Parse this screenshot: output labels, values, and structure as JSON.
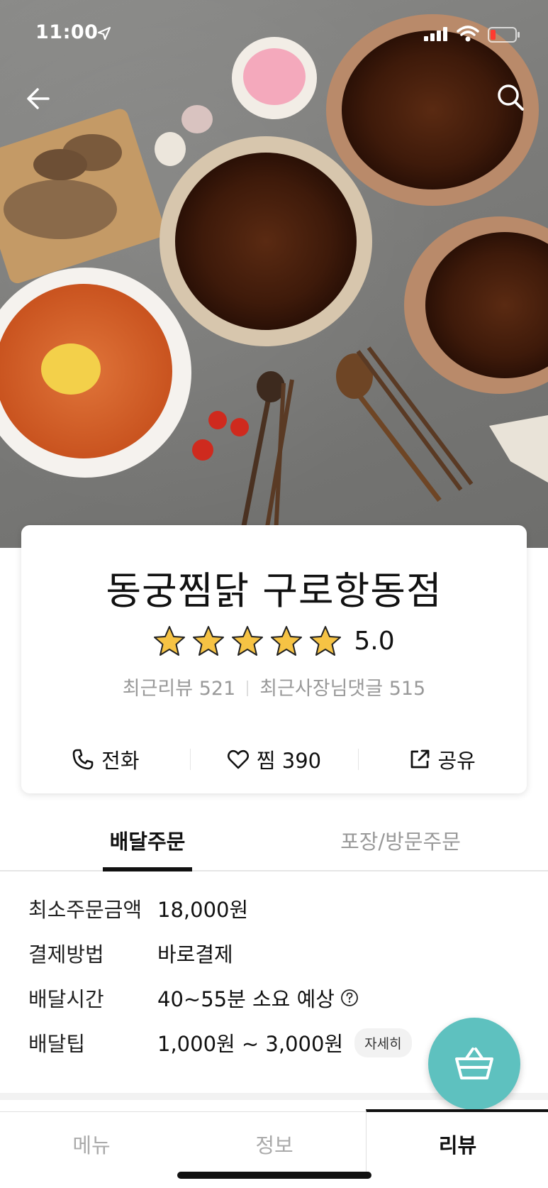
{
  "status_bar": {
    "time": "11:00"
  },
  "store": {
    "name": "동궁찜닭 구로항동점",
    "rating": "5.0",
    "stars": 5,
    "recent_reviews": "최근리뷰 521",
    "owner_replies": "최근사장님댓글 515"
  },
  "actions": {
    "call_label": "전화",
    "like_label": "찜 390",
    "share_label": "공유"
  },
  "order_tabs": {
    "delivery": "배달주문",
    "pickup": "포장/방문주문"
  },
  "info": {
    "min_order_key": "최소주문금액",
    "min_order_value": "18,000원",
    "payment_key": "결제방법",
    "payment_value": "바로결제",
    "delivery_time_key": "배달시간",
    "delivery_time_value": "40~55분 소요 예상",
    "delivery_tip_key": "배달팁",
    "delivery_tip_value": "1,000원 ~ 3,000원",
    "detail_label": "자세히"
  },
  "bottom_nav": {
    "menu": "메뉴",
    "info": "정보",
    "review": "리뷰"
  },
  "colors": {
    "accent": "#5ec1bf",
    "star": "#f6c344"
  }
}
